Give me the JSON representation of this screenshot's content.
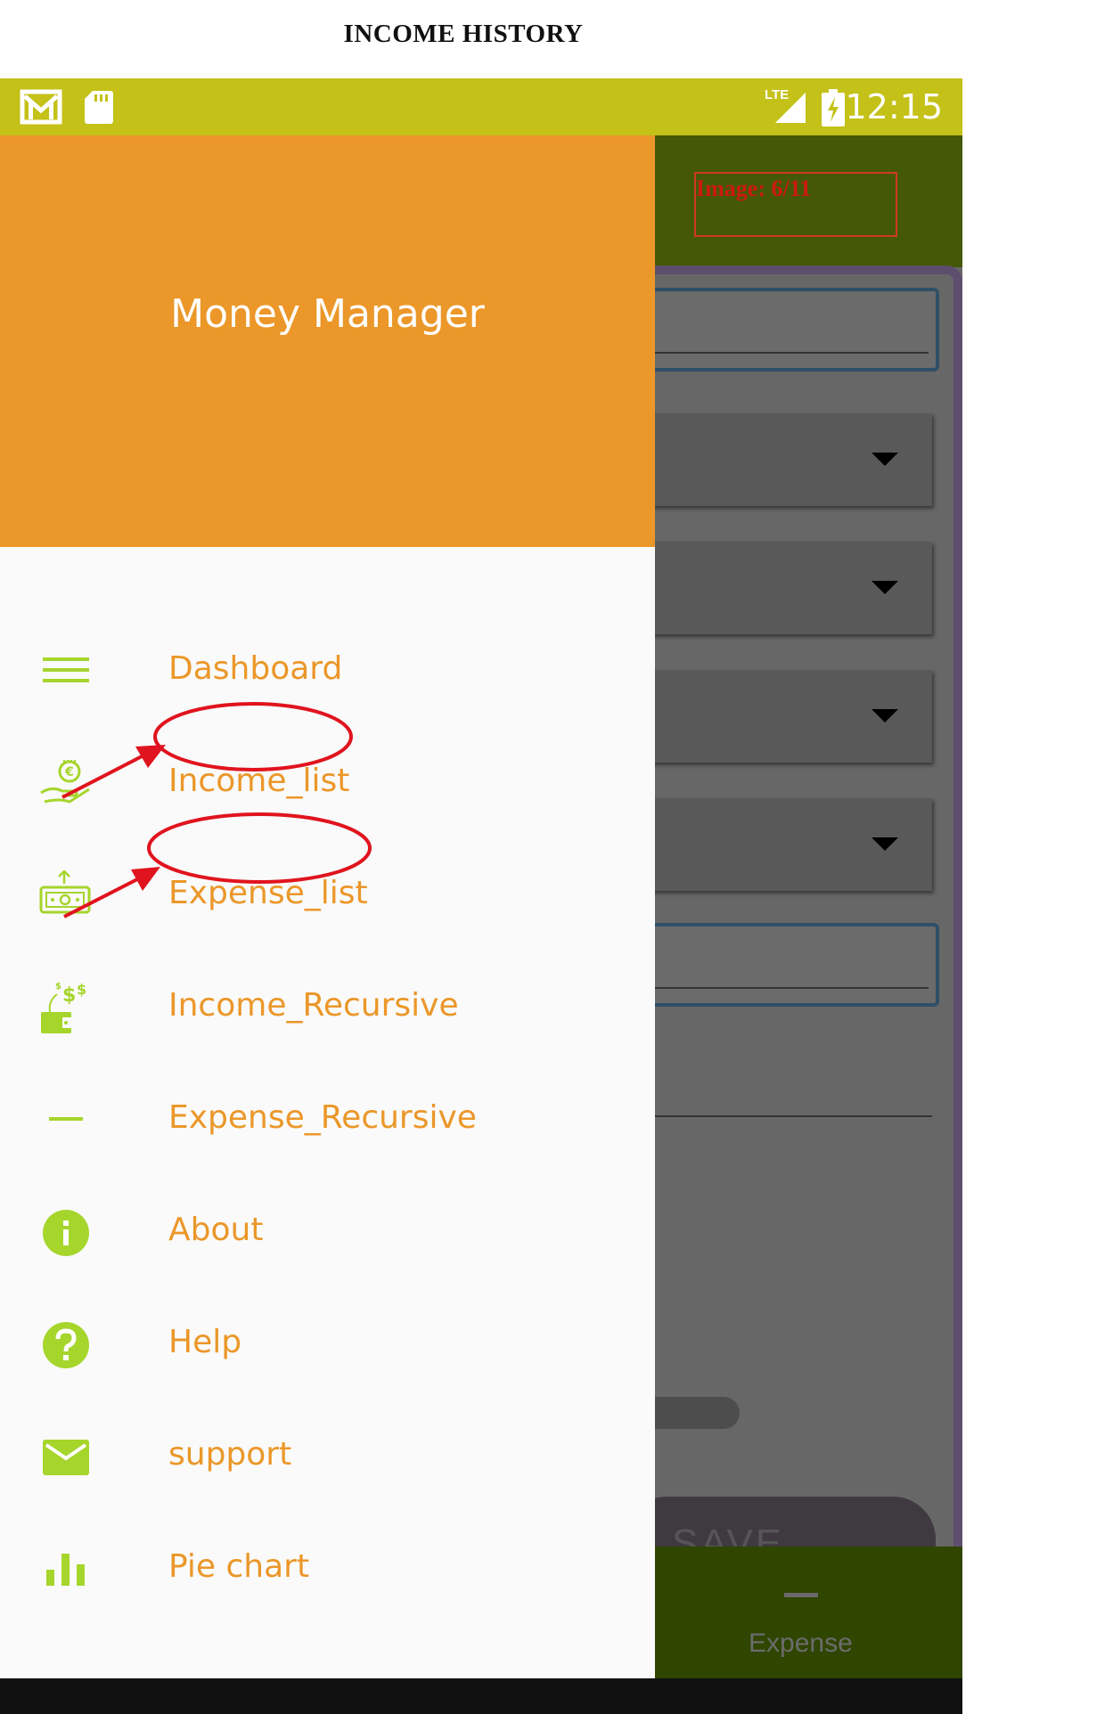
{
  "document": {
    "title": "INCOME HISTORY"
  },
  "status_bar": {
    "time": "12:15",
    "network": "LTE"
  },
  "overlay": {
    "label": "Image: 6/11"
  },
  "drawer": {
    "title": "Money Manager",
    "items": [
      {
        "label": "Dashboard",
        "icon": "menu-lines-icon"
      },
      {
        "label": "Income_list",
        "icon": "hand-money-icon"
      },
      {
        "label": "Expense_list",
        "icon": "cash-out-icon"
      },
      {
        "label": "Income_Recursive",
        "icon": "wallet-dollar-icon"
      },
      {
        "label": "Expense_Recursive",
        "icon": "minus-icon"
      },
      {
        "label": "About",
        "icon": "info-icon"
      },
      {
        "label": "Help",
        "icon": "help-icon"
      },
      {
        "label": "support",
        "icon": "mail-icon"
      },
      {
        "label": "Pie chart",
        "icon": "bar-chart-icon"
      }
    ]
  },
  "app": {
    "save_label": "SAVE",
    "bottom_nav_label": "Expense"
  },
  "colors": {
    "accent": "#eb9729",
    "icon_green": "#a6d52c",
    "status_bar": "#c4c118",
    "app_bar": "#445808",
    "annotation_red": "#e0141e"
  }
}
